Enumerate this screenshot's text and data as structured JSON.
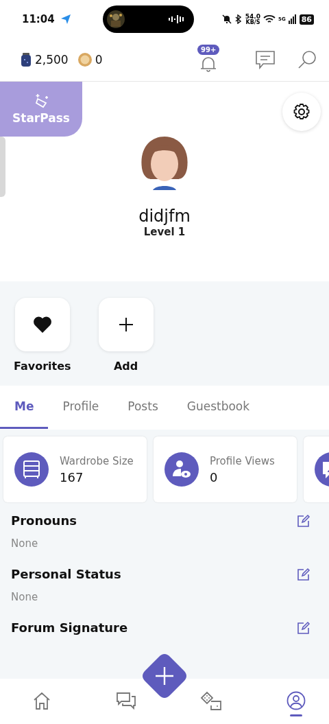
{
  "status_bar": {
    "time": "11:04",
    "speed": "54.0",
    "speed_unit": "KB/S",
    "network": "5G",
    "battery": "86"
  },
  "top_bar": {
    "currencies": [
      {
        "kind": "jar",
        "amount": "2,500"
      },
      {
        "kind": "coin",
        "amount": "0"
      }
    ],
    "notification_badge": "99+"
  },
  "starpass": {
    "label": "StarPass"
  },
  "profile": {
    "username": "didjfm",
    "level": "Level 1"
  },
  "quick_actions": [
    {
      "kind": "heart",
      "label": "Favorites"
    },
    {
      "kind": "plus",
      "label": "Add"
    }
  ],
  "tabs": [
    {
      "label": "Me",
      "selected": true
    },
    {
      "label": "Profile",
      "selected": false
    },
    {
      "label": "Posts",
      "selected": false
    },
    {
      "label": "Guestbook",
      "selected": false
    }
  ],
  "stats": [
    {
      "kind": "wardrobe",
      "label": "Wardrobe Size",
      "value": "167"
    },
    {
      "kind": "views",
      "label": "Profile Views",
      "value": "0"
    },
    {
      "kind": "chat"
    }
  ],
  "fields": [
    {
      "title": "Pronouns",
      "value": "None"
    },
    {
      "title": "Personal Status",
      "value": "None"
    },
    {
      "title": "Forum Signature"
    }
  ],
  "bottom_nav": [
    {
      "kind": "home",
      "selected": false
    },
    {
      "kind": "chat",
      "selected": false
    },
    {
      "kind": "dice",
      "selected": false
    },
    {
      "kind": "profile",
      "selected": true
    }
  ]
}
